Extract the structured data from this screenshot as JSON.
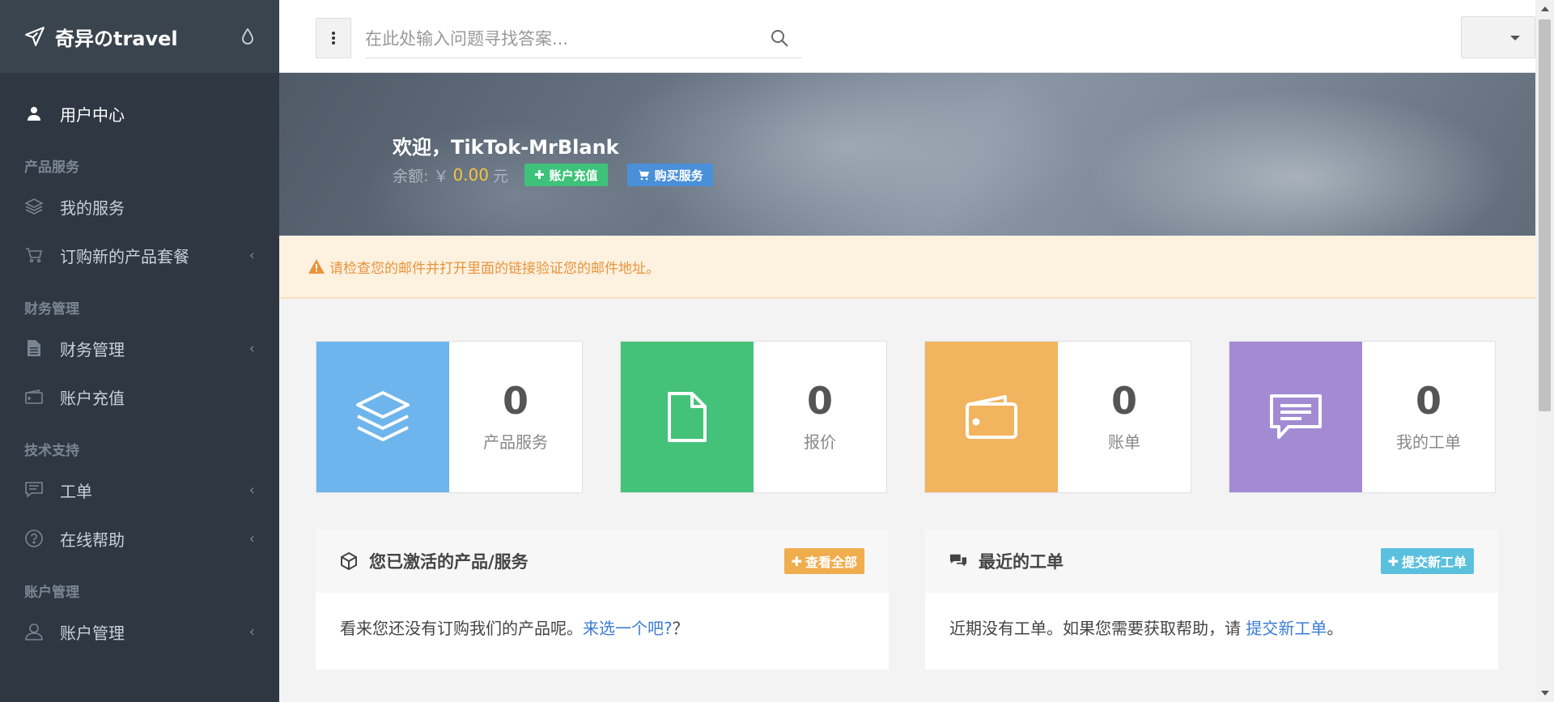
{
  "brand": {
    "title": "奇异のtravel"
  },
  "sidebar": {
    "user_center": "用户中心",
    "sections": {
      "products": "产品服务",
      "finance": "财务管理",
      "support": "技术支持",
      "account": "账户管理"
    },
    "items": {
      "my_services": "我的服务",
      "order_new": "订购新的产品套餐",
      "finance_mgmt": "财务管理",
      "recharge": "账户充值",
      "tickets": "工单",
      "online_help": "在线帮助",
      "account_mgmt": "账户管理"
    }
  },
  "search": {
    "placeholder": "在此处输入问题寻找答案..."
  },
  "hero": {
    "welcome": "欢迎，TikTok-MrBlank",
    "balance_label": "余额: ￥",
    "balance_amount": "0.00",
    "balance_unit": "元",
    "recharge_button": "账户充值",
    "buy_button": "购买服务"
  },
  "alert": {
    "text": "请检查您的邮件并打开里面的链接验证您的邮件地址。"
  },
  "stats": [
    {
      "value": "0",
      "label": "产品服务",
      "color": "#6db5ec",
      "icon": "layers-icon"
    },
    {
      "value": "0",
      "label": "报价",
      "color": "#44c279",
      "icon": "document-icon"
    },
    {
      "value": "0",
      "label": "账单",
      "color": "#f2b45f",
      "icon": "wallet-icon"
    },
    {
      "value": "0",
      "label": "我的工单",
      "color": "#a38bd4",
      "icon": "chat-icon"
    }
  ],
  "panels": {
    "services": {
      "title": "您已激活的产品/服务",
      "button": "查看全部",
      "button_color": "#f0ad4e",
      "text_before": "看来您还没有订购我们的产品呢。",
      "link": "来选一个吧?",
      "text_after": "？"
    },
    "tickets": {
      "title": "最近的工单",
      "button": "提交新工单",
      "button_color": "#5bc0de",
      "text_before": "近期没有工单。如果您需要获取帮助，请 ",
      "link": "提交新工单",
      "text_after": "。"
    }
  }
}
